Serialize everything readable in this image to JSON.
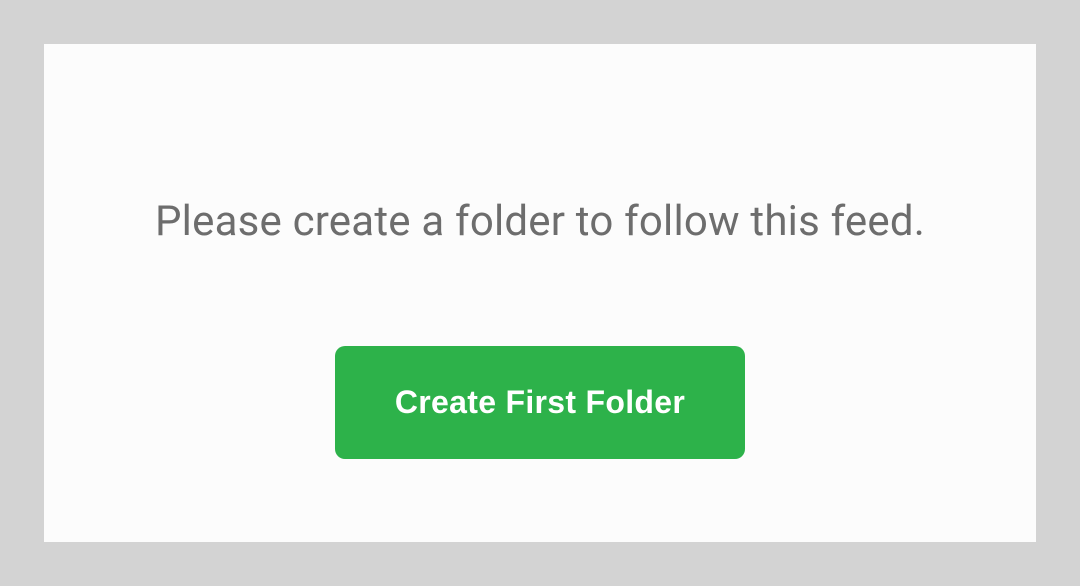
{
  "dialog": {
    "message": "Please create a folder to follow this feed.",
    "button_label": "Create First Folder"
  }
}
